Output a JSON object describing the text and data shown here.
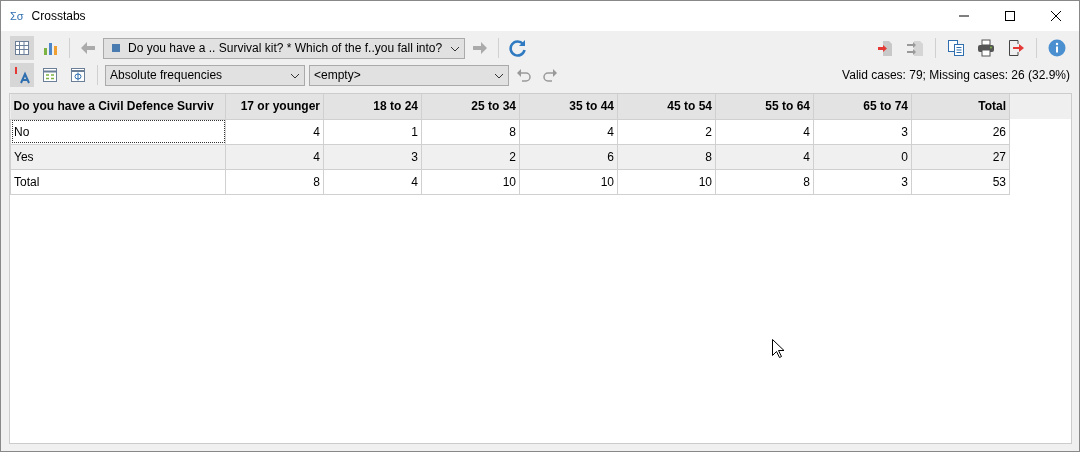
{
  "window": {
    "app_icon": "Σσ",
    "title": "Crosstabs"
  },
  "toolbar": {
    "views": [
      {
        "kind": "table",
        "selected": true
      },
      {
        "kind": "chart",
        "selected": false
      }
    ],
    "back": {
      "disabled": true
    },
    "variable": "Do you have a .. Survival kit? * Which of the f..you fall into?",
    "forward": {
      "disabled": true
    }
  },
  "toolbar2": {
    "options": [
      {
        "kind": "labels",
        "selected": true
      },
      {
        "kind": "list",
        "selected": false
      },
      {
        "kind": "phi",
        "selected": false
      }
    ],
    "statistic": "Absolute frequencies",
    "second": "<empty>",
    "undo": {
      "disabled": true
    },
    "redo": {
      "disabled": true
    }
  },
  "status": "Valid cases: 79;  Missing cases: 26 (32.9%)",
  "table": {
    "columns": [
      "Do you have a Civil Defence Surviv",
      "17 or younger",
      "18 to 24",
      "25 to 34",
      "35 to 44",
      "45 to 54",
      "55 to 64",
      "65 to 74",
      "Total"
    ],
    "rows": [
      {
        "focused": true,
        "cells": [
          "No",
          "4",
          "1",
          "8",
          "4",
          "2",
          "4",
          "3",
          "26"
        ]
      },
      {
        "focused": false,
        "cells": [
          "Yes",
          "4",
          "3",
          "2",
          "6",
          "8",
          "4",
          "0",
          "27"
        ]
      },
      {
        "focused": false,
        "cells": [
          "Total",
          "8",
          "4",
          "10",
          "10",
          "10",
          "8",
          "3",
          "53"
        ]
      }
    ]
  }
}
